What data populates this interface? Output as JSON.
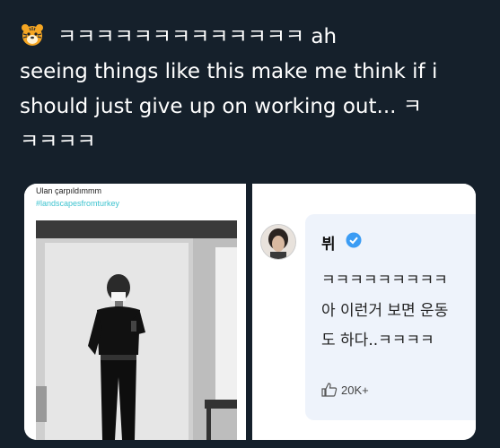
{
  "tweet": {
    "line1": "ㅋㅋㅋㅋㅋㅋㅋㅋㅋㅋㅋㅋㅋ ah",
    "line2": "seeing things like this make me think if i",
    "line3": "should just give up on working out... ㅋ",
    "line4": "ㅋㅋㅋㅋ",
    "emoji": "tiger-face-icon"
  },
  "left_panel": {
    "username": "Ulan çarpıldımmm",
    "hashtag": "#landscapesfromturkey"
  },
  "right_panel": {
    "name": "뷔",
    "line1": "ㅋㅋㅋㅋㅋㅋㅋㅋㅋ",
    "line2": "아 이런거 보면 운동",
    "line3": "도 하다..ㅋㅋㅋㅋ",
    "likes": "20K+"
  },
  "colors": {
    "background": "#15202b",
    "hashtag": "#3dc3cf",
    "verified": "#3b9cf4"
  }
}
